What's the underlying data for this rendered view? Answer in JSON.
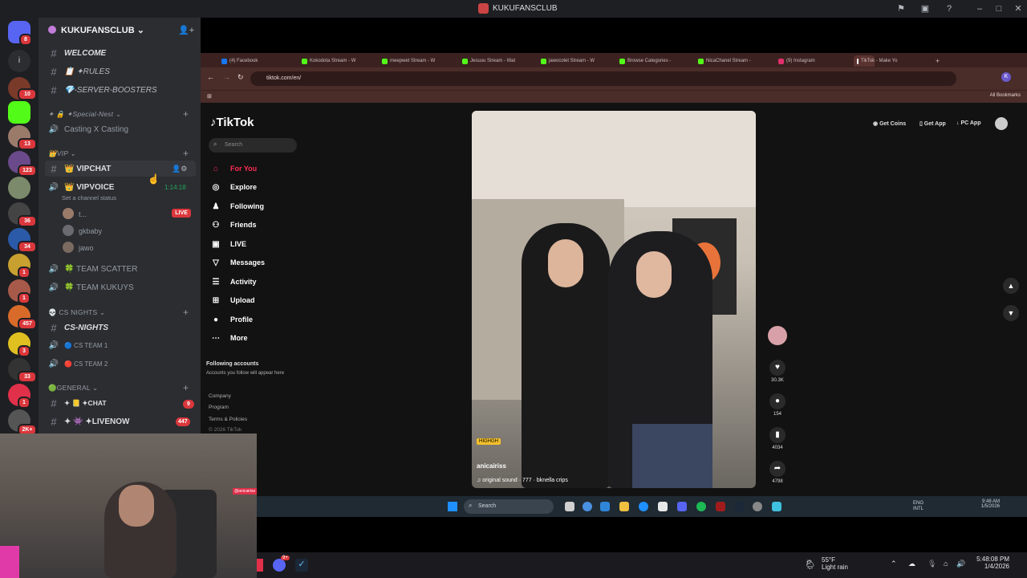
{
  "window": {
    "title": "KUKUFANSCLUB"
  },
  "rail_badges": [
    "8",
    "10",
    "13",
    "123",
    "36",
    "34",
    "1",
    "1",
    "457",
    "3",
    "33",
    "1",
    "2K+"
  ],
  "server": {
    "name": "KUKUFANSCLUB",
    "channels_top": [
      {
        "name": "WELCOME"
      },
      {
        "name": "📋 ✦RULES"
      },
      {
        "name": "💎-SERVER-BOOSTERS"
      }
    ],
    "category_special": "✦ 🔒 ✦Special-Nest ⌄",
    "casting": "Casting X Casting",
    "category_vip": "👑VIP ⌄",
    "vipchat": "👑 VIPCHAT",
    "vipvoice": "👑 VIPVOICE",
    "vipvoice_time": "1:14:18",
    "vipvoice_status": "Set a channel status",
    "voice_users": [
      "t...",
      "gkbaby",
      "jawo"
    ],
    "live_label": "LIVE",
    "team_scatter": "🍀 TEAM SCATTER",
    "team_kukuys": "🍀 TEAM KUKUYS",
    "category_cs": "💀 CS NIGHTS ⌄",
    "cs_nights": "CS-NIGHTS",
    "cs_team1": "🔵 CS TEAM 1",
    "cs_team2": "🔴 CS TEAM 2",
    "category_general": "🟢GENERAL ⌄",
    "chat": "✦ 📒 ✦CHAT",
    "chat_badge": "9",
    "livenow": "✦ 👾 ✦LIVENOW",
    "livenow_badge": "447"
  },
  "browser": {
    "tabs": [
      "(4) Facebook",
      "Kokodota Stream - W",
      "meepwet Stream - W",
      "Jesuuu Stream - Wat",
      "jawocolet Stream - W",
      "Browse Categories -",
      "NicaChanel Stream -",
      "(9) Instagram",
      "TikTok - Make Yo"
    ],
    "url": "tiktok.com/en/",
    "bookmarks": "All Bookmarks"
  },
  "tiktok": {
    "logo": "TikTok",
    "search_placeholder": "Search",
    "nav": [
      "For You",
      "Explore",
      "Following",
      "Friends",
      "LIVE",
      "Messages",
      "Activity",
      "Upload",
      "Profile",
      "More"
    ],
    "following_accounts": "Following accounts",
    "following_hint": "Accounts you follow will appear here",
    "footer": [
      "Company",
      "Program",
      "Terms & Policies",
      "© 2026 TikTok"
    ],
    "top_buttons": [
      "Get Coins",
      "Get App",
      "PC App"
    ],
    "video": {
      "tag": "HIGHGH",
      "username": "anicairiss",
      "sound": "original sound · 777 · bknella crips",
      "likes": "30.3K",
      "comments": "154",
      "saves": "4034",
      "shares": "4798"
    },
    "cam_tag": "@anicairiss"
  },
  "inner_taskbar": {
    "search": "Search",
    "lang": "ENG INTL",
    "time": "9:48 AM",
    "date": "1/5/2026"
  },
  "taskbar": {
    "temp": "55°F",
    "weather": "Light rain",
    "time": "5:48:08 PM",
    "date": "1/4/2026",
    "discord_badge": "9+"
  }
}
